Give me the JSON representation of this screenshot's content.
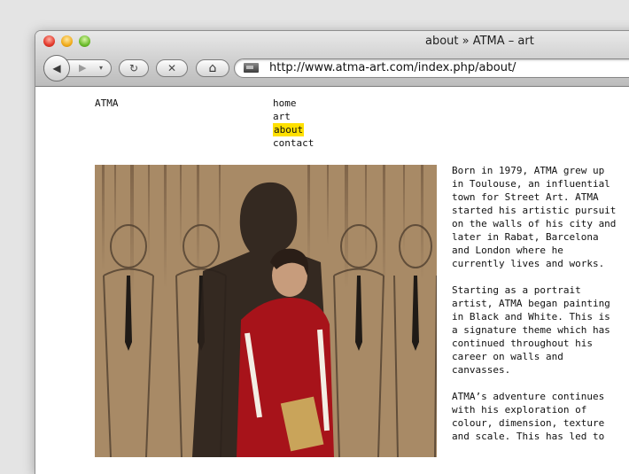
{
  "window": {
    "title": "about » ATMA – art",
    "url": "http://www.atma-art.com/index.php/about/"
  },
  "toolbar": {
    "back_glyph": "◀",
    "forward_glyph": "▶",
    "dropdown_glyph": "▾",
    "reload_glyph": "↻",
    "stop_glyph": "✕",
    "home_glyph": "⌂"
  },
  "site": {
    "logo": "ATMA",
    "nav": [
      {
        "label": "home"
      },
      {
        "label": "art"
      },
      {
        "label": "about",
        "active": true
      },
      {
        "label": "contact"
      }
    ]
  },
  "bio": {
    "paragraphs": [
      "Born in 1979, ATMA grew up\nin Toulouse, an influential\ntown for Street Art. ATMA\nstarted his artistic pursuit\non the walls of his city and\nlater in Rabat, Barcelona\nand London where he\ncurrently lives and works.",
      "Starting as a portrait\nartist, ATMA began painting\nin Black and White. This is\na signature theme which has\ncontinued throughout his\ncareer on walls and\ncanvasses.",
      "ATMA’s adventure continues\nwith his exploration of\ncolour, dimension, texture\nand scale. This has led to"
    ]
  },
  "colors": {
    "nav_highlight": "#ffe000",
    "traffic_red": "#e3392b",
    "traffic_yellow": "#f1ac1b",
    "traffic_green": "#6cbc2c"
  }
}
